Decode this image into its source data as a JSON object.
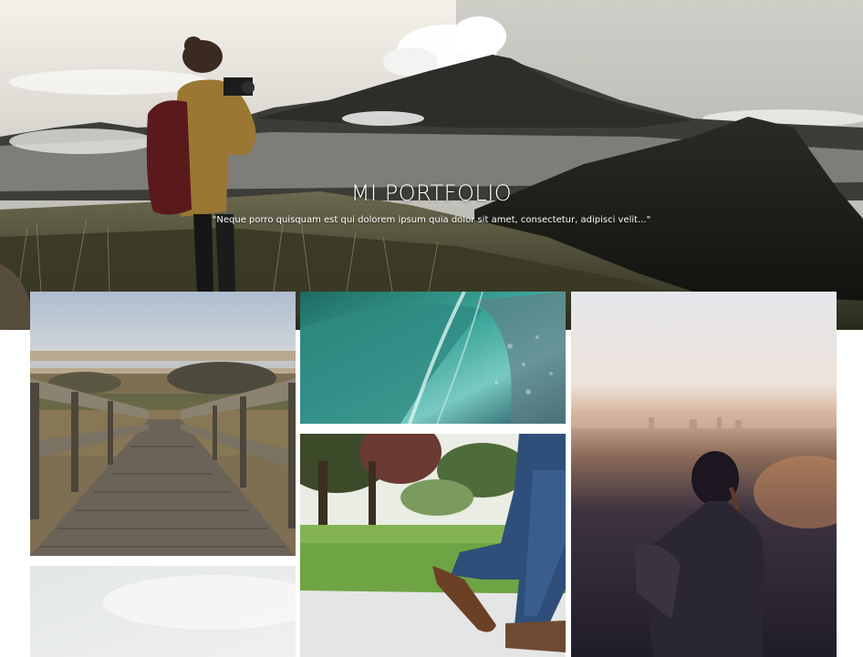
{
  "hero": {
    "title": "MI PORTFOLIO",
    "subtitle": "\"Neque porro quisquam est qui dolorem ipsum quia dolor sit amet, consectetur, adipisci velit...\""
  },
  "gallery": {
    "items": [
      {
        "subject": "wooden boardwalk through marsh"
      },
      {
        "subject": "turquoise ocean wave"
      },
      {
        "subject": "person walking on path, legs in jeans"
      },
      {
        "subject": "woman overlooking city at sunset"
      },
      {
        "subject": "foggy pale sky"
      }
    ]
  },
  "colors": {
    "hero_text": "#ffffff",
    "page_background": "#ffffff"
  }
}
